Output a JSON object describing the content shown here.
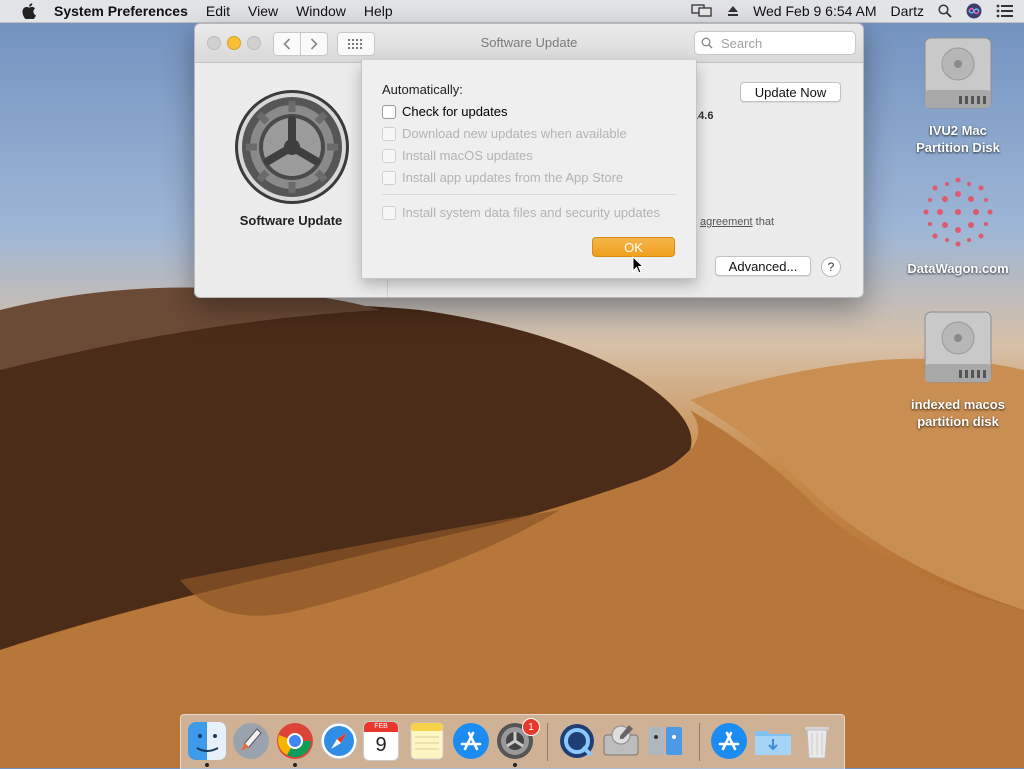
{
  "menubar": {
    "app_name": "System Preferences",
    "items": [
      "Edit",
      "View",
      "Window",
      "Help"
    ],
    "datetime": "Wed Feb 9  6:54 AM",
    "user": "Dartz"
  },
  "window": {
    "title": "Software Update",
    "search_placeholder": "Search",
    "pref_label": "Software Update",
    "update_now_label": "Update Now",
    "version_fragment": ".14.6",
    "agreement_fragment_link": "agreement",
    "agreement_fragment_rest": " that",
    "advanced_label": "Advanced...",
    "help_label": "?"
  },
  "sheet": {
    "heading": "Automatically:",
    "options": [
      {
        "label": "Check for updates",
        "checked": false,
        "enabled": true
      },
      {
        "label": "Download new updates when available",
        "checked": false,
        "enabled": false
      },
      {
        "label": "Install macOS updates",
        "checked": false,
        "enabled": false
      },
      {
        "label": "Install app updates from the App Store",
        "checked": false,
        "enabled": false
      },
      {
        "label": "Install system data files and security updates",
        "checked": false,
        "enabled": false
      }
    ],
    "ok_label": "OK"
  },
  "desktop": {
    "icons": [
      {
        "label_line1": "IVU2 Mac",
        "label_line2": "Partition Disk",
        "type": "drive-icon"
      },
      {
        "label_line1": "DataWagon.com",
        "label_line2": "",
        "type": "image-icon"
      },
      {
        "label_line1": "indexed macos",
        "label_line2": "partition disk",
        "type": "drive-icon"
      }
    ]
  },
  "dock": {
    "calendar_month": "FEB",
    "calendar_day": "9",
    "sysprefs_badge": "1",
    "apps": [
      "finder-icon",
      "launchpad-icon",
      "chrome-icon",
      "safari-icon",
      "calendar-icon",
      "notes-icon",
      "app-store-icon",
      "system-preferences-icon",
      "quicktime-icon",
      "disk-utility-icon",
      "migration-assistant-icon",
      "app-store-icon",
      "downloads-folder-icon",
      "trash-icon"
    ]
  },
  "colors": {
    "accent": "#F0A11E",
    "close_inactive": "#D0D0D0",
    "minimize": "#F7BE36"
  }
}
